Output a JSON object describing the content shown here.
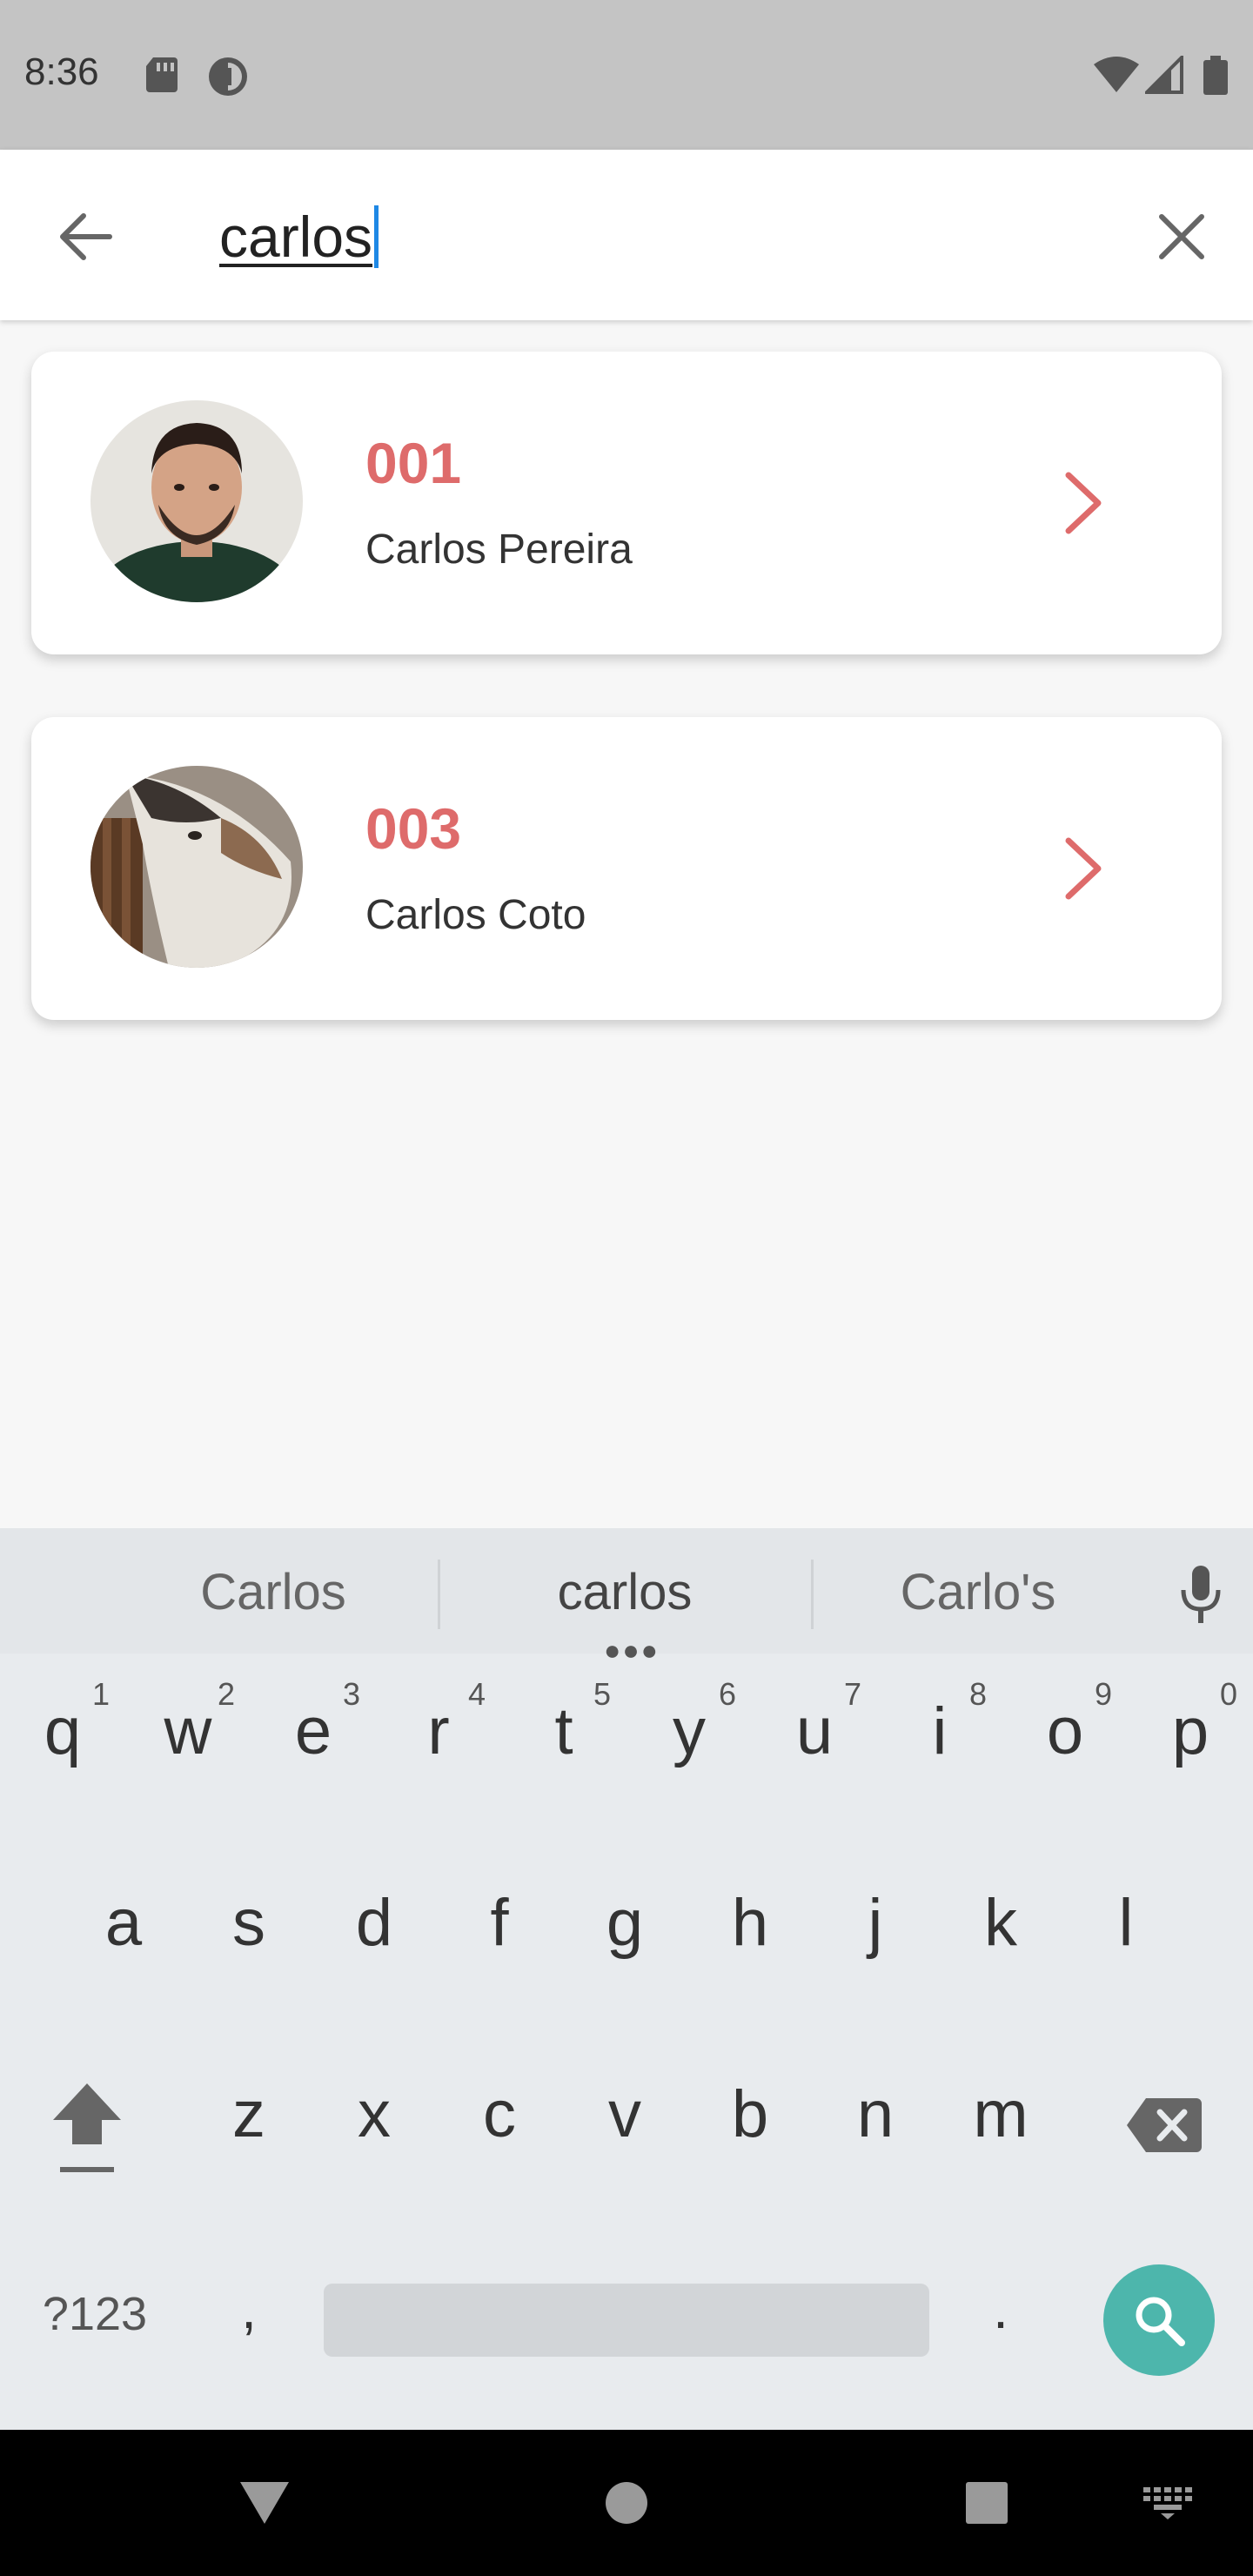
{
  "status_bar": {
    "time": "8:36"
  },
  "search": {
    "query": "carlos"
  },
  "results": [
    {
      "code": "001",
      "name": "Carlos Pereira"
    },
    {
      "code": "003",
      "name": "Carlos Coto"
    }
  ],
  "keyboard": {
    "suggestions": [
      "Carlos",
      "carlos",
      "Carlo's"
    ],
    "row1": [
      "q",
      "w",
      "e",
      "r",
      "t",
      "y",
      "u",
      "i",
      "o",
      "p"
    ],
    "row1_hints": [
      "1",
      "2",
      "3",
      "4",
      "5",
      "6",
      "7",
      "8",
      "9",
      "0"
    ],
    "row2": [
      "a",
      "s",
      "d",
      "f",
      "g",
      "h",
      "j",
      "k",
      "l"
    ],
    "row3": [
      "z",
      "x",
      "c",
      "v",
      "b",
      "n",
      "m"
    ],
    "symbols_key": "?123",
    "comma_key": ",",
    "period_key": "."
  },
  "colors": {
    "accent": "#de6b6b",
    "search_key": "#4db6ac",
    "caret": "#1e88e5"
  }
}
